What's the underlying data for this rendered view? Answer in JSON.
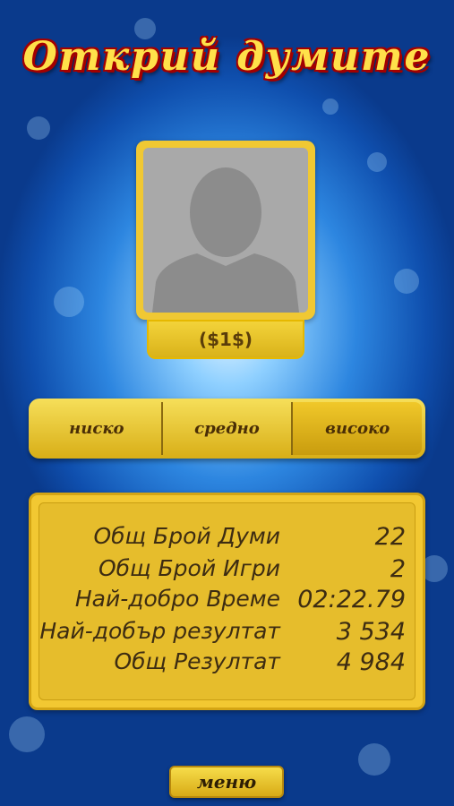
{
  "title": "Открий думите",
  "profile": {
    "price": "($1$)"
  },
  "difficulty": {
    "options": [
      {
        "label": "ниско"
      },
      {
        "label": "средно"
      },
      {
        "label": "високо"
      }
    ],
    "selected": "високо"
  },
  "stats": [
    {
      "label": "Общ Брой Думи",
      "value": "22"
    },
    {
      "label": "Общ Брой Игри",
      "value": "2"
    },
    {
      "label": "Най-добро Време",
      "value": "02:22.79"
    },
    {
      "label": "Най-добър резултат",
      "value": "3 534"
    },
    {
      "label": "Общ Резултат",
      "value": "4 984"
    }
  ],
  "menu_label": "меню",
  "colors": {
    "accent": "#f2c832",
    "background": "#1c6ac9"
  }
}
